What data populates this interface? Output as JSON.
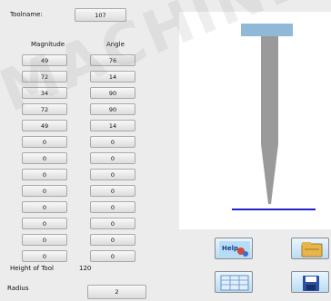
{
  "toolname": {
    "label": "Toolname:",
    "value": "107"
  },
  "table": {
    "headers": {
      "magnitude": "Magnitude",
      "angle": "Angle"
    },
    "magnitudes": [
      "49",
      "72",
      "34",
      "72",
      "49",
      "0",
      "0",
      "0",
      "0",
      "0",
      "0",
      "0",
      "0"
    ],
    "angles": [
      "76",
      "14",
      "90",
      "90",
      "14",
      "0",
      "0",
      "0",
      "0",
      "0",
      "0",
      "0",
      "0"
    ]
  },
  "height_of_tool": {
    "label": "Height of Tool",
    "value": "120"
  },
  "radius": {
    "label": "Radius",
    "value": "2"
  },
  "watermark": "MACHINERYHOUSE",
  "icons": [
    "help-icon",
    "open-folder-icon",
    "grid-icon",
    "save-disk-icon"
  ],
  "colors": {
    "tool_top": "#8fb9d6",
    "tool_body": "#9a9a9a",
    "baseline": "#2222cc"
  }
}
